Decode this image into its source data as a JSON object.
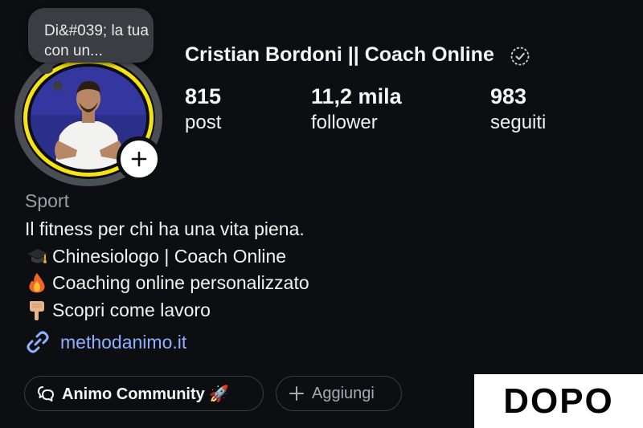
{
  "note": {
    "text": "Di&#039; la tua con un..."
  },
  "profile": {
    "name": "Cristian Bordoni || Coach Online",
    "verified_icon": "verified-badge-icon",
    "stats": [
      {
        "value": "815",
        "label": "post"
      },
      {
        "value": "11,2 mila",
        "label": "follower"
      },
      {
        "value": "983",
        "label": "seguiti"
      }
    ]
  },
  "bio": {
    "category": "Sport",
    "lines": [
      "Il fitness per chi ha una vita piena.",
      "Chinesiologo | Coach Online",
      "Coaching online personalizzato",
      "Scopri come lavoro"
    ],
    "link": "methodanimo.it"
  },
  "chips": [
    {
      "label": "Animo Community 🚀"
    },
    {
      "label": "Aggiungi"
    }
  ],
  "overlay_label": "DOPO",
  "colors": {
    "background": "#0c0e12",
    "story_ring": "#f6e312",
    "link": "#8fb0ff",
    "secondary_text": "#9a9ea5"
  }
}
